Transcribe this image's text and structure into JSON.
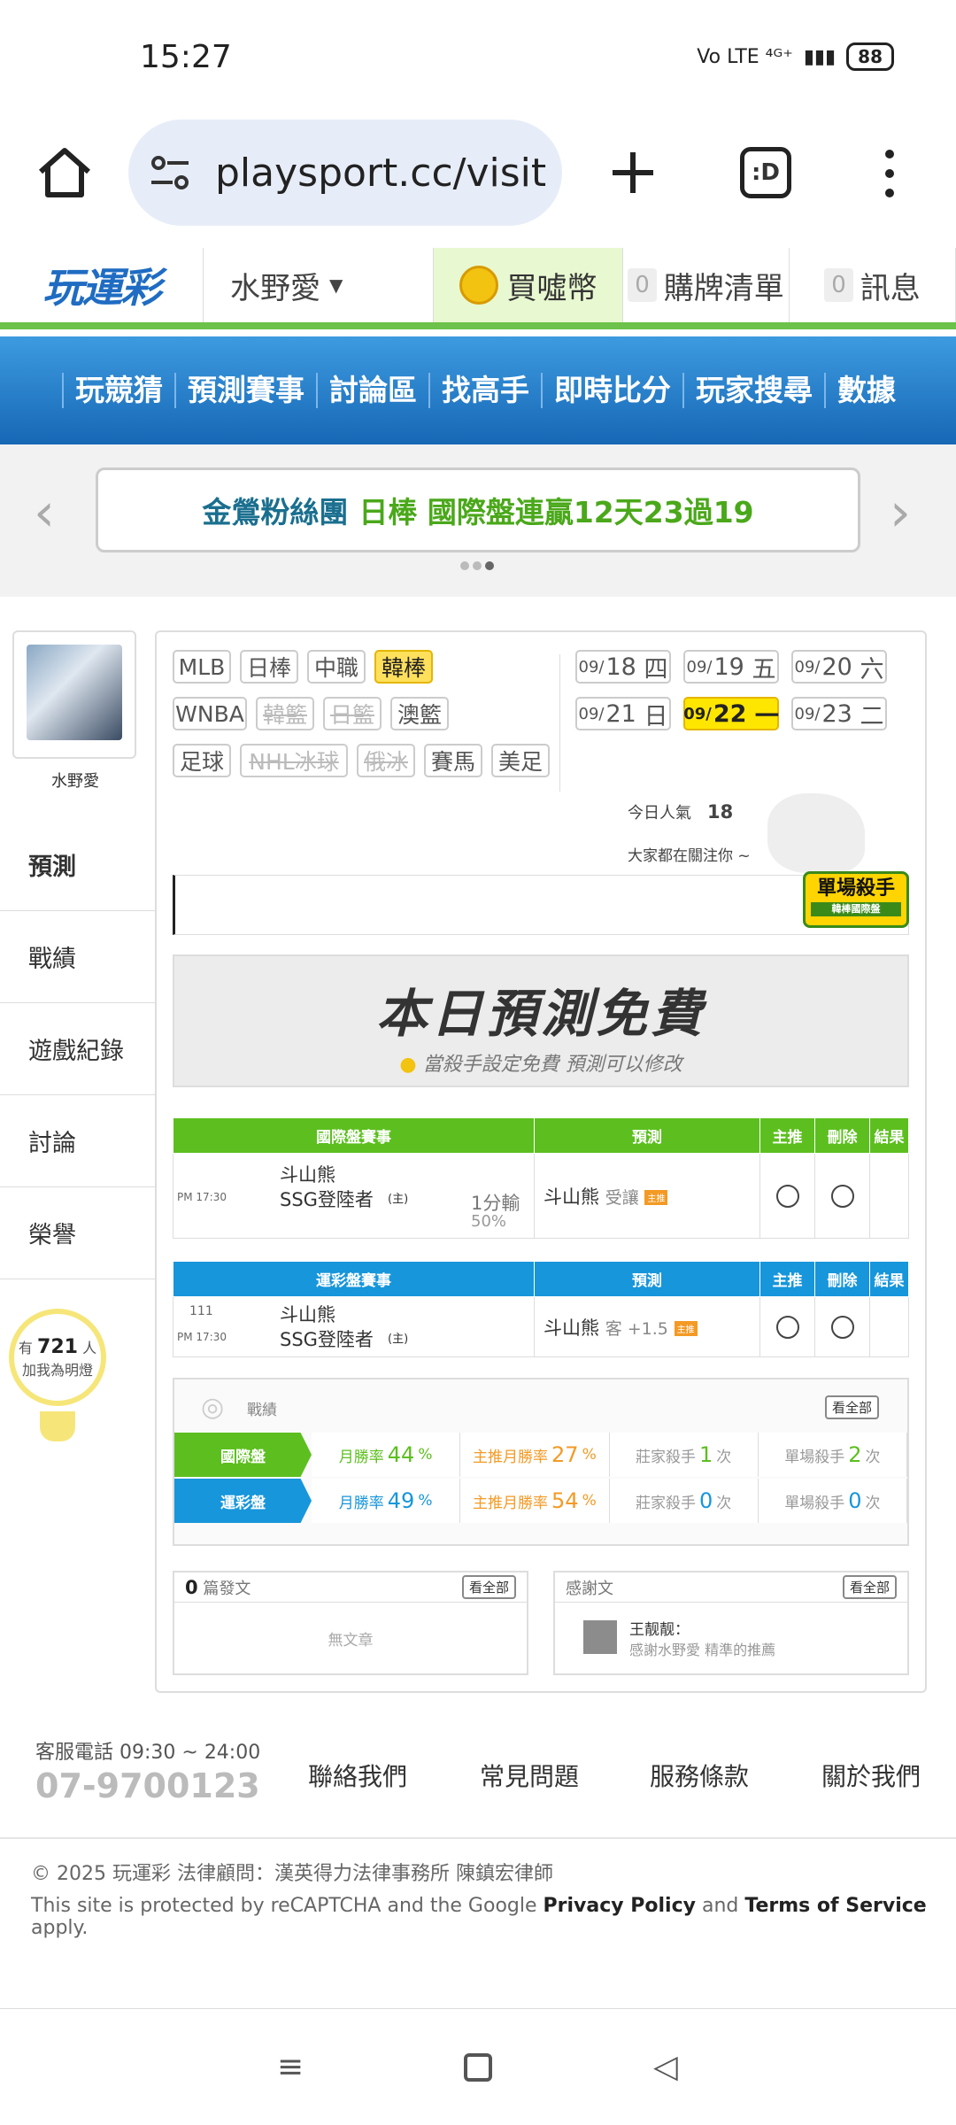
{
  "status": {
    "time": "15:27",
    "network": "Vo LTE ⁴ᴳ⁺",
    "battery": "88"
  },
  "browser": {
    "url": "playsport.cc/visit",
    "tabs_label": ":D"
  },
  "topnav": {
    "logo": "玩運彩",
    "user": "水野愛",
    "coin": "買噓幣",
    "cart_count": "0",
    "cart": "購牌清單",
    "msg_count": "0",
    "msg": "訊息"
  },
  "menu": [
    "玩競猜",
    "預測賽事",
    "討論區",
    "找高手",
    "即時比分",
    "玩家搜尋",
    "數據"
  ],
  "promo": {
    "p1": "金鶯粉絲團",
    "p2": "日棒 國際盤連贏12天23過19"
  },
  "profile": {
    "name": "水野愛"
  },
  "sidenav": [
    "預測",
    "戰績",
    "遊戲紀錄",
    "討論",
    "榮譽"
  ],
  "bulb": {
    "pre": "有",
    "count": "721",
    "post": "人",
    "sub": "加我為明燈"
  },
  "sports_row1": [
    "MLB",
    "日棒",
    "中職",
    "韓棒"
  ],
  "sports_row2": [
    "WNBA",
    "韓籃",
    "日籃",
    "澳籃"
  ],
  "sports_row3": [
    "足球",
    "NHL冰球",
    "俄冰",
    "賽馬",
    "美足"
  ],
  "dates": [
    {
      "md": "09/",
      "d": "18",
      "w": "四"
    },
    {
      "md": "09/",
      "d": "19",
      "w": "五"
    },
    {
      "md": "09/",
      "d": "20",
      "w": "六"
    },
    {
      "md": "09/",
      "d": "21",
      "w": "日"
    },
    {
      "md": "09/",
      "d": "22",
      "w": "一"
    },
    {
      "md": "09/",
      "d": "23",
      "w": "二"
    }
  ],
  "popularity": {
    "label": "今日人氣",
    "value": "18",
    "follow": "大家都在關注你 ~"
  },
  "killer": {
    "title": "單場殺手",
    "sub": "韓棒國際盤"
  },
  "free": {
    "title": "本日預測免費",
    "sub": "當殺手設定免費 預測可以修改"
  },
  "table1": {
    "h": [
      "國際盤賽事",
      "預測",
      "主推",
      "刪除",
      "結果"
    ],
    "time": "PM 17:30",
    "team1": "斗山熊",
    "team2": "SSG登陸者",
    "home": "(主)",
    "line": "1分輸",
    "pct": "50%",
    "pick": "斗山熊",
    "pick_type": "受讓",
    "mark": "主推"
  },
  "table2": {
    "h": [
      "運彩盤賽事",
      "預測",
      "主推",
      "刪除",
      "結果"
    ],
    "num": "111",
    "time": "PM 17:30",
    "team1": "斗山熊",
    "team2": "SSG登陸者",
    "home": "(主)",
    "pick": "斗山熊",
    "pick_type": "客 +1.5",
    "mark": "主推"
  },
  "stats": {
    "title": "戰績",
    "all": "看全部",
    "r1": {
      "lbl": "國際盤",
      "a": "月勝率",
      "av": "44",
      "b": "主推月勝率",
      "bv": "27",
      "c": "莊家殺手",
      "cv": "1",
      "d": "單場殺手",
      "dv": "2",
      "pct": "%",
      "unit": "次"
    },
    "r2": {
      "lbl": "運彩盤",
      "a": "月勝率",
      "av": "49",
      "b": "主推月勝率",
      "bv": "54",
      "c": "莊家殺手",
      "cv": "0",
      "d": "單場殺手",
      "dv": "0",
      "pct": "%",
      "unit": "次"
    }
  },
  "posts": {
    "count": "0",
    "label": "篇發文",
    "all": "看全部",
    "empty": "無文章"
  },
  "thanks": {
    "label": "感謝文",
    "all": "看全部",
    "user": "王靓靓：",
    "text": "感謝水野愛 精準的推薦"
  },
  "footer": {
    "tel_label": "客服電話 09:30 ~ 24:00",
    "tel": "07-9700123",
    "links": [
      "聯絡我們",
      "常見問題",
      "服務條款",
      "關於我們"
    ]
  },
  "copyright": "© 2025 玩運彩 法律顧問：漢英得力法律事務所 陳鎮宏律師",
  "recaptcha": {
    "pre": "This site is protected by reCAPTCHA and the Google ",
    "pp": "Privacy Policy",
    "and": " and ",
    "tos": "Terms of Service",
    "post": " apply."
  }
}
